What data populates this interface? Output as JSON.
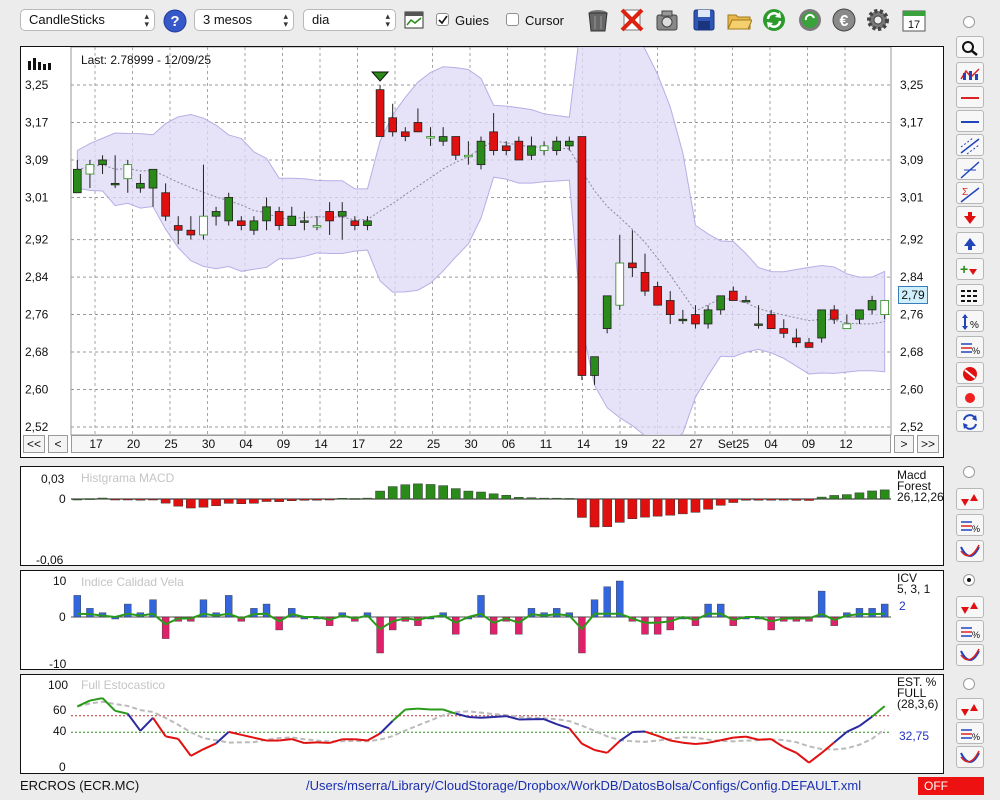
{
  "toolbar": {
    "chart_type": "CandleSticks",
    "period": "3 mesos",
    "interval": "dia",
    "guides_label": "Guies",
    "guides_checked": true,
    "cursor_label": "Cursor",
    "cursor_checked": false,
    "calendar_day": "17"
  },
  "main_chart": {
    "last_label": "Last: 2.78999 - 12/09/25",
    "current_price": "2,79",
    "y_ticks": [
      "3,25",
      "3,17",
      "3,09",
      "3,01",
      "2,92",
      "2,84",
      "2,76",
      "2,68",
      "2,60",
      "2,52"
    ],
    "x_labels": [
      "17",
      "20",
      "25",
      "30",
      "04",
      "09",
      "14",
      "17",
      "22",
      "25",
      "30",
      "06",
      "11",
      "14",
      "19",
      "22",
      "27",
      "Set25",
      "04",
      "09",
      "12"
    ],
    "nav": {
      "first": "<<",
      "prev": "<",
      "next": ">",
      "last": ">>"
    }
  },
  "macd_panel": {
    "title": "Histgrama MACD",
    "y_top": "0,03",
    "y_zero": "0",
    "y_bottom": "-0,06",
    "label_line1": "Macd",
    "label_line2": "Forest",
    "label_line3": "26,12,26"
  },
  "icv_panel": {
    "title": "Indice Calidad Vela",
    "y_top": "10",
    "y_zero": "0",
    "y_bottom": "-10",
    "label_line1": "ICV",
    "label_line2": "5, 3, 1",
    "value": "2"
  },
  "stoch_panel": {
    "title": "Full Estocastico",
    "y_ticks": [
      "100",
      "60",
      "40",
      "0"
    ],
    "label_line1": "EST. %",
    "label_line2": "FULL",
    "label_line3": "(28,3,6)",
    "value": "32,75"
  },
  "status": {
    "ticker": "ERCROS (ECR.MC)",
    "config_path": "/Users/mserra/Library/CloudStorage/Dropbox/WorkDB/DatosBolsa/Configs/Config.DEFAULT.xml",
    "mode": "OFF"
  },
  "colors": {
    "bull": "#2a8a1a",
    "bear": "#e01010",
    "band": "#ddd8f4",
    "accent": "#2233bb"
  },
  "chart_data": {
    "type": "candlestick",
    "ylim": [
      2.52,
      3.25
    ],
    "candles": [
      {
        "o": 3.02,
        "h": 3.09,
        "l": 3.02,
        "c": 3.07
      },
      {
        "o": 3.06,
        "h": 3.09,
        "l": 3.03,
        "c": 3.08
      },
      {
        "o": 3.08,
        "h": 3.1,
        "l": 3.06,
        "c": 3.09
      },
      {
        "o": 3.04,
        "h": 3.1,
        "l": 3.03,
        "c": 3.04
      },
      {
        "o": 3.05,
        "h": 3.09,
        "l": 3.02,
        "c": 3.08
      },
      {
        "o": 3.03,
        "h": 3.06,
        "l": 3.02,
        "c": 3.04
      },
      {
        "o": 3.03,
        "h": 3.07,
        "l": 2.99,
        "c": 3.07
      },
      {
        "o": 3.02,
        "h": 3.04,
        "l": 2.96,
        "c": 2.97
      },
      {
        "o": 2.95,
        "h": 2.97,
        "l": 2.91,
        "c": 2.94
      },
      {
        "o": 2.94,
        "h": 2.97,
        "l": 2.92,
        "c": 2.93
      },
      {
        "o": 2.93,
        "h": 3.08,
        "l": 2.92,
        "c": 2.97
      },
      {
        "o": 2.97,
        "h": 2.99,
        "l": 2.95,
        "c": 2.98
      },
      {
        "o": 2.96,
        "h": 3.02,
        "l": 2.95,
        "c": 3.01
      },
      {
        "o": 2.96,
        "h": 2.97,
        "l": 2.94,
        "c": 2.95
      },
      {
        "o": 2.94,
        "h": 2.97,
        "l": 2.93,
        "c": 2.96
      },
      {
        "o": 2.96,
        "h": 3.01,
        "l": 2.94,
        "c": 2.99
      },
      {
        "o": 2.98,
        "h": 2.99,
        "l": 2.94,
        "c": 2.95
      },
      {
        "o": 2.95,
        "h": 2.99,
        "l": 2.95,
        "c": 2.97
      },
      {
        "o": 2.96,
        "h": 2.98,
        "l": 2.94,
        "c": 2.96
      },
      {
        "o": 2.95,
        "h": 2.97,
        "l": 2.94,
        "c": 2.95
      },
      {
        "o": 2.98,
        "h": 3.0,
        "l": 2.93,
        "c": 2.96
      },
      {
        "o": 2.97,
        "h": 3.0,
        "l": 2.92,
        "c": 2.98
      },
      {
        "o": 2.96,
        "h": 2.97,
        "l": 2.94,
        "c": 2.95
      },
      {
        "o": 2.95,
        "h": 2.97,
        "l": 2.94,
        "c": 2.96
      },
      {
        "o": 3.24,
        "h": 3.25,
        "l": 3.14,
        "c": 3.14
      },
      {
        "o": 3.18,
        "h": 3.21,
        "l": 3.14,
        "c": 3.15
      },
      {
        "o": 3.15,
        "h": 3.16,
        "l": 3.13,
        "c": 3.14
      },
      {
        "o": 3.17,
        "h": 3.2,
        "l": 3.15,
        "c": 3.15
      },
      {
        "o": 3.14,
        "h": 3.16,
        "l": 3.12,
        "c": 3.14
      },
      {
        "o": 3.13,
        "h": 3.16,
        "l": 3.12,
        "c": 3.14
      },
      {
        "o": 3.14,
        "h": 3.14,
        "l": 3.09,
        "c": 3.1
      },
      {
        "o": 3.1,
        "h": 3.13,
        "l": 3.08,
        "c": 3.1
      },
      {
        "o": 3.08,
        "h": 3.14,
        "l": 3.07,
        "c": 3.13
      },
      {
        "o": 3.15,
        "h": 3.19,
        "l": 3.1,
        "c": 3.11
      },
      {
        "o": 3.12,
        "h": 3.13,
        "l": 3.1,
        "c": 3.11
      },
      {
        "o": 3.13,
        "h": 3.14,
        "l": 3.09,
        "c": 3.09
      },
      {
        "o": 3.1,
        "h": 3.14,
        "l": 3.09,
        "c": 3.12
      },
      {
        "o": 3.11,
        "h": 3.13,
        "l": 3.1,
        "c": 3.12
      },
      {
        "o": 3.11,
        "h": 3.14,
        "l": 3.1,
        "c": 3.13
      },
      {
        "o": 3.12,
        "h": 3.14,
        "l": 3.11,
        "c": 3.13
      },
      {
        "o": 3.14,
        "h": 3.14,
        "l": 2.62,
        "c": 2.63
      },
      {
        "o": 2.63,
        "h": 2.64,
        "l": 2.61,
        "c": 2.67
      },
      {
        "o": 2.73,
        "h": 2.8,
        "l": 2.72,
        "c": 2.8
      },
      {
        "o": 2.78,
        "h": 2.93,
        "l": 2.77,
        "c": 2.87
      },
      {
        "o": 2.87,
        "h": 2.94,
        "l": 2.84,
        "c": 2.86
      },
      {
        "o": 2.85,
        "h": 2.89,
        "l": 2.8,
        "c": 2.81
      },
      {
        "o": 2.82,
        "h": 2.83,
        "l": 2.78,
        "c": 2.78
      },
      {
        "o": 2.79,
        "h": 2.81,
        "l": 2.74,
        "c": 2.76
      },
      {
        "o": 2.75,
        "h": 2.77,
        "l": 2.74,
        "c": 2.75
      },
      {
        "o": 2.76,
        "h": 2.78,
        "l": 2.73,
        "c": 2.74
      },
      {
        "o": 2.74,
        "h": 2.78,
        "l": 2.73,
        "c": 2.77
      },
      {
        "o": 2.77,
        "h": 2.8,
        "l": 2.76,
        "c": 2.8
      },
      {
        "o": 2.81,
        "h": 2.82,
        "l": 2.79,
        "c": 2.79
      },
      {
        "o": 2.79,
        "h": 2.8,
        "l": 2.79,
        "c": 2.79
      },
      {
        "o": 2.74,
        "h": 2.78,
        "l": 2.73,
        "c": 2.74
      },
      {
        "o": 2.76,
        "h": 2.77,
        "l": 2.73,
        "c": 2.73
      },
      {
        "o": 2.73,
        "h": 2.75,
        "l": 2.71,
        "c": 2.72
      },
      {
        "o": 2.71,
        "h": 2.73,
        "l": 2.69,
        "c": 2.7
      },
      {
        "o": 2.7,
        "h": 2.71,
        "l": 2.69,
        "c": 2.69
      },
      {
        "o": 2.71,
        "h": 2.77,
        "l": 2.7,
        "c": 2.77
      },
      {
        "o": 2.77,
        "h": 2.78,
        "l": 2.74,
        "c": 2.75
      },
      {
        "o": 2.73,
        "h": 2.76,
        "l": 2.73,
        "c": 2.74
      },
      {
        "o": 2.75,
        "h": 2.77,
        "l": 2.74,
        "c": 2.77
      },
      {
        "o": 2.77,
        "h": 2.8,
        "l": 2.76,
        "c": 2.79
      },
      {
        "o": 2.76,
        "h": 2.79,
        "l": 2.75,
        "c": 2.79
      }
    ]
  }
}
